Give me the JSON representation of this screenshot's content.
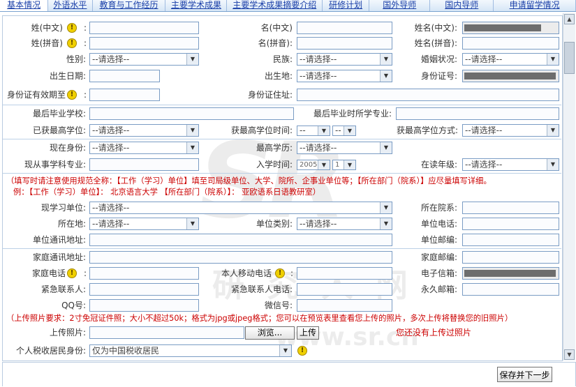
{
  "tabs": [
    "基本情况",
    "外语水平",
    "教育与工作经历",
    "主要学术成果",
    "主要学术成果摘要介绍",
    "研修计划",
    "国外导师",
    "国内导师",
    "申请留学情况"
  ],
  "form": {
    "surname_cn": "姓(中文)",
    "given_cn": "名(中文)",
    "fullname_cn": "姓名(中文):",
    "surname_py": "姓(拼音)",
    "given_py": "名(拼音):",
    "fullname_py": "姓名(拼音):",
    "gender": "性别:",
    "ethnic": "民族:",
    "marital": "婚姻状况:",
    "birthdate": "出生日期:",
    "birthplace": "出生地:",
    "idno": "身份证号:",
    "id_valid": "身份证有效期至",
    "id_addr": "身份证住址:",
    "last_school": "最后毕业学校:",
    "last_major": "最后毕业时所学专业:",
    "highest_degree": "已获最高学位:",
    "degree_time": "获最高学位时间:",
    "degree_method": "获最高学位方式:",
    "current_status": "现在身份:",
    "highest_edu": "最高学历:",
    "current_major": "现从事学科专业:",
    "enroll_time": "入学时间:",
    "grade": "在读年级:",
    "unit": "现学习单位:",
    "college": "所在院系:",
    "location": "所在地:",
    "unit_type": "单位类别:",
    "unit_phone": "单位电话:",
    "unit_addr": "单位通讯地址:",
    "unit_zip": "单位邮编:",
    "home_addr": "家庭通讯地址:",
    "home_zip": "家庭邮编:",
    "home_phone": "家庭电话",
    "mobile": "本人移动电话",
    "email": "电子信箱:",
    "emergency": "紧急联系人:",
    "emergency_phone": "紧急联系人电话:",
    "perm_zip": "永久邮箱:",
    "qq": "QQ号:",
    "wechat": "微信号:",
    "photo": "上传照片:",
    "tax": "个人税收居民身份:"
  },
  "placeholder_select": "--请选择--",
  "sel_year": "2005",
  "sel_month": "1",
  "sel_dash": "--",
  "tax_value": "仅为中国税收居民",
  "note1": "（填写时请注意使用规范全称：【工作（学习）单位】填至司局级单位、大学、院所、企事业单位等；【所在部门（院系）】应尽量填写详细。",
  "note2": "例：【工作（学习）单位】：  北京语言大学      【所在部门（院系）】：  亚欧语系日语教研室）",
  "photo_note": "（上传照片要求：2寸免冠证件照；大小不超过50k；格式为jpg或jpeg格式；您可以在预览表里查看您上传的照片，多次上传将替换您的旧照片）",
  "browse": "浏览...",
  "upload": "上传",
  "no_photo": "您还没有上传过照片",
  "save_next": "保存并下一步",
  "watermark_brand": "SR",
  "watermark_cn": "研 究 人 网",
  "watermark_url": "www.sr.cn",
  "colors": {
    "tab_text": "#1a3fa8",
    "note": "#cc0000",
    "border": "#7a9cc4"
  }
}
